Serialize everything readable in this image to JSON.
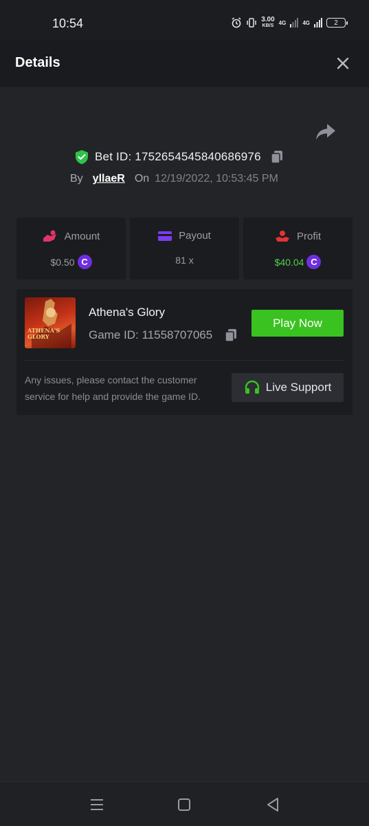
{
  "status_bar": {
    "time": "10:54",
    "net_speed": "3.00",
    "net_unit": "KB/S",
    "net1": "4G",
    "net2": "4G",
    "battery": "2"
  },
  "header": {
    "title": "Details",
    "close_icon": "close-icon"
  },
  "bet": {
    "label": "Bet ID: 1752654545840686976",
    "by_label": "By",
    "user": "yllaeR",
    "on_label": "On",
    "datetime": "12/19/2022, 10:53:45 PM"
  },
  "stats": {
    "amount": {
      "label": "Amount",
      "value": "$0.50",
      "icon": "hand-coins-icon",
      "color": "#e0356a"
    },
    "payout": {
      "label": "Payout",
      "value": "81 x",
      "icon": "card-icon",
      "color": "#7b3cf0"
    },
    "profit": {
      "label": "Profit",
      "value": "$40.04",
      "icon": "hand-give-icon",
      "color": "#e03535"
    }
  },
  "coin_symbol": "C",
  "game": {
    "title": "Athena's Glory",
    "thumb_text_1": "ATHENA'S",
    "thumb_text_2": "GLORY",
    "id_label": "Game ID: 11558707065",
    "play_label": "Play Now",
    "help": "Any issues, please contact the customer service for help and provide the game ID.",
    "support_label": "Live Support"
  },
  "colors": {
    "accent_green": "#3ac221",
    "coin_purple": "#6f2ee0",
    "profit_green": "#4fd34a"
  }
}
